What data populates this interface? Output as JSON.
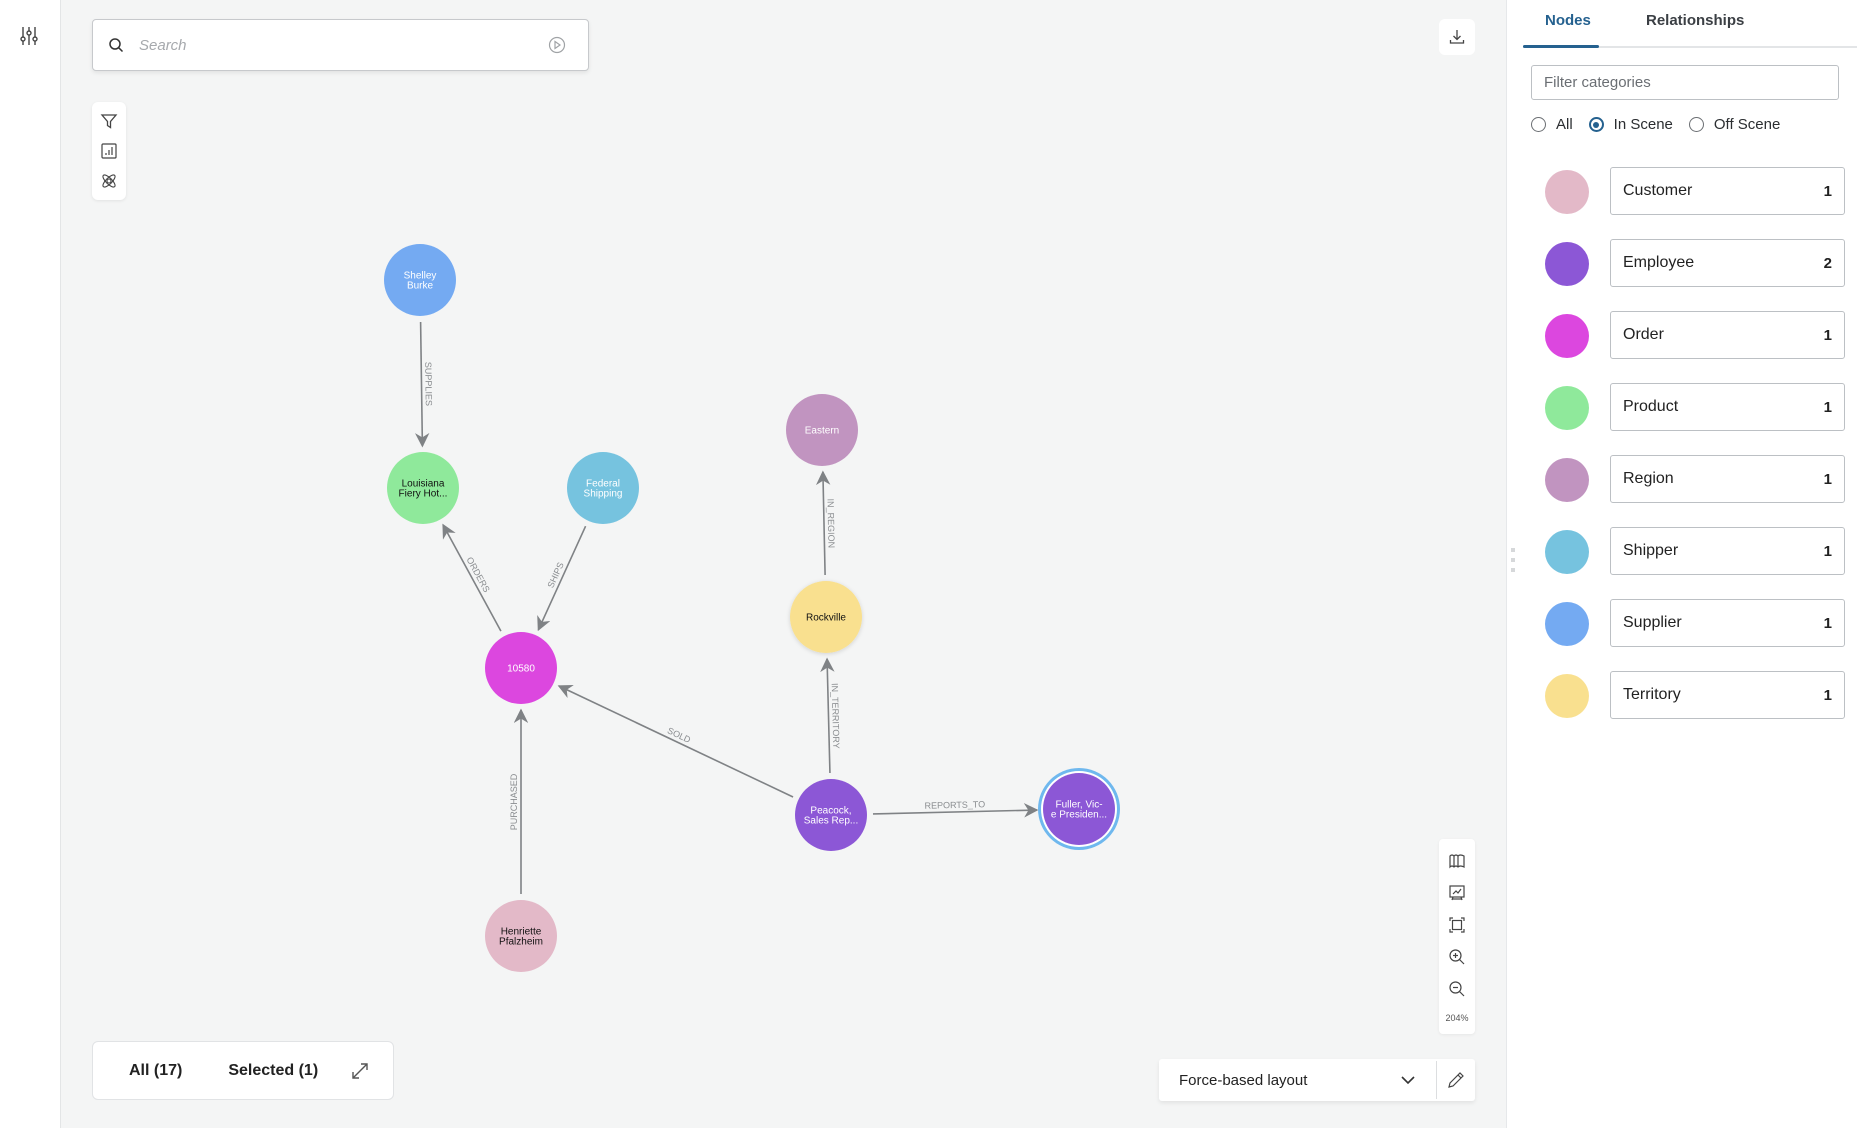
{
  "left_rail": {
    "settings_icon": "sliders-icon"
  },
  "search": {
    "placeholder": "Search",
    "value": ""
  },
  "tools": [
    {
      "name": "filter",
      "icon": "funnel-icon"
    },
    {
      "name": "statistics",
      "icon": "bar-chart-icon"
    },
    {
      "name": "graph-algorithms",
      "icon": "atom-icon"
    }
  ],
  "download": {
    "icon": "download-icon"
  },
  "zoom_controls": {
    "buttons": [
      "map-icon",
      "presentation-icon",
      "fit-screen-icon",
      "zoom-in-icon",
      "zoom-out-icon"
    ],
    "zoom_level": "204%"
  },
  "counts": {
    "all": "All (17)",
    "selected": "Selected (1)"
  },
  "layout": {
    "selected": "Force-based layout"
  },
  "panel": {
    "tabs": [
      {
        "label": "Nodes",
        "active": true
      },
      {
        "label": "Relationships",
        "active": false
      }
    ],
    "filter_placeholder": "Filter categories",
    "radio_options": [
      {
        "label": "All",
        "checked": false
      },
      {
        "label": "In Scene",
        "checked": true
      },
      {
        "label": "Off Scene",
        "checked": false
      }
    ],
    "categories": [
      {
        "name": "Customer",
        "count": "1",
        "color": "#e3b9c8"
      },
      {
        "name": "Employee",
        "count": "2",
        "color": "#8c57d6"
      },
      {
        "name": "Order",
        "count": "1",
        "color": "#dc47df"
      },
      {
        "name": "Product",
        "count": "1",
        "color": "#8fe99b"
      },
      {
        "name": "Region",
        "count": "1",
        "color": "#c194c0"
      },
      {
        "name": "Shipper",
        "count": "1",
        "color": "#76c3df"
      },
      {
        "name": "Supplier",
        "count": "1",
        "color": "#74aaf2"
      },
      {
        "name": "Territory",
        "count": "1",
        "color": "#f9e08f"
      }
    ]
  },
  "graph": {
    "nodes": [
      {
        "id": "shelley",
        "lines": [
          "Shelley",
          "Burke"
        ],
        "category": "Supplier",
        "text_color": "#ffffff"
      },
      {
        "id": "louisiana",
        "lines": [
          "Louisiana",
          "Fiery Hot..."
        ],
        "category": "Product",
        "text_color": "#111111"
      },
      {
        "id": "federal",
        "lines": [
          "Federal",
          "Shipping"
        ],
        "category": "Shipper",
        "text_color": "#ffffff"
      },
      {
        "id": "order",
        "lines": [
          "10580"
        ],
        "category": "Order",
        "text_color": "#ffffff"
      },
      {
        "id": "eastern",
        "lines": [
          "Eastern"
        ],
        "category": "Region",
        "text_color": "#ffffff"
      },
      {
        "id": "rockville",
        "lines": [
          "Rockville"
        ],
        "category": "Territory",
        "text_color": "#111111"
      },
      {
        "id": "peacock",
        "lines": [
          "Peacock,",
          "Sales Rep..."
        ],
        "category": "Employee",
        "text_color": "#ffffff"
      },
      {
        "id": "fuller",
        "lines": [
          "Fuller, Vic-",
          "e Presiden..."
        ],
        "category": "Employee",
        "text_color": "#ffffff",
        "selected": true
      },
      {
        "id": "henriette",
        "lines": [
          "Henriette",
          "Pfalzheim"
        ],
        "category": "Customer",
        "text_color": "#111111"
      }
    ],
    "edges": [
      {
        "from": "shelley",
        "to": "louisiana",
        "label": "SUPPLIES"
      },
      {
        "from": "order",
        "to": "louisiana",
        "label": "ORDERS"
      },
      {
        "from": "federal",
        "to": "order",
        "label": "SHIPS"
      },
      {
        "from": "peacock",
        "to": "order",
        "label": "SOLD"
      },
      {
        "from": "henriette",
        "to": "order",
        "label": "PURCHASED"
      },
      {
        "from": "rockville",
        "to": "eastern",
        "label": "IN_REGION"
      },
      {
        "from": "peacock",
        "to": "rockville",
        "label": "IN_TERRITORY"
      },
      {
        "from": "peacock",
        "to": "fuller",
        "label": "REPORTS_TO"
      }
    ]
  }
}
